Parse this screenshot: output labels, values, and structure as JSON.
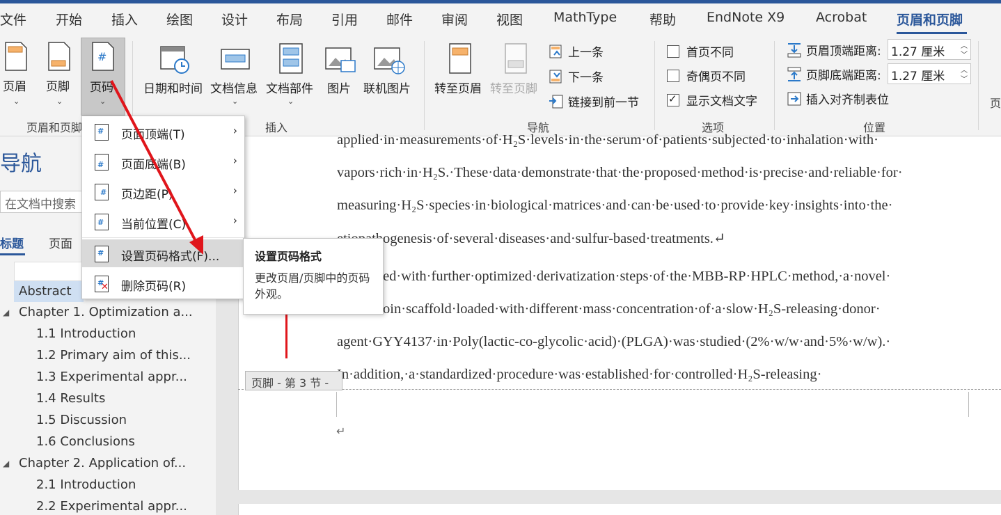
{
  "tabs": [
    "文件",
    "开始",
    "插入",
    "绘图",
    "设计",
    "布局",
    "引用",
    "邮件",
    "审阅",
    "视图",
    "MathType",
    "帮助",
    "EndNote X9",
    "Acrobat",
    "页眉和页脚"
  ],
  "ribbon": {
    "header_label": "页眉",
    "footer_label": "页脚",
    "page_number_label": "页码",
    "group_header_footer": "页眉和页脚",
    "datetime_label": "日期和时间",
    "docinfo_label": "文档信息",
    "docparts_label": "文档部件",
    "picture_label": "图片",
    "online_picture_label": "联机图片",
    "group_insert": "插入",
    "goto_header_label": "转至页眉",
    "goto_footer_label": "转至页脚",
    "prev_label": "上一条",
    "next_label": "下一条",
    "link_prev_label": "链接到前一节",
    "group_nav": "导航",
    "diff_first_label": "首页不同",
    "diff_oddeven_label": "奇偶页不同",
    "show_doc_text_label": "显示文档文字",
    "show_doc_text_checked": true,
    "group_options": "选项",
    "header_top_label": "页眉顶端距离:",
    "header_top_value": "1.27 厘米",
    "footer_bottom_label": "页脚底端距离:",
    "footer_bottom_value": "1.27 厘米",
    "insert_align_tab_label": "插入对齐制表位",
    "group_position": "位置",
    "cut_right_label": "页"
  },
  "dropdown": {
    "items": [
      {
        "label": "页面顶端(T)",
        "submenu": true
      },
      {
        "label": "页面底端(B)",
        "submenu": true
      },
      {
        "label": "页边距(P)",
        "submenu": true
      },
      {
        "label": "当前位置(C)",
        "submenu": true
      },
      {
        "label": "设置页码格式(F)...",
        "submenu": false
      },
      {
        "label": "删除页码(R)",
        "submenu": false
      }
    ]
  },
  "tooltip": {
    "title": "设置页码格式",
    "body": "更改页眉/页脚中的页码外观。"
  },
  "nav": {
    "title": "导航",
    "search_placeholder": "在文档中搜索",
    "tab_headings": "标题",
    "tab_pages": "页面",
    "items": [
      {
        "label": "Abstract",
        "level": 1
      },
      {
        "label": "Chapter 1. Optimization a...",
        "level": 1
      },
      {
        "label": "1.1 Introduction",
        "level": 2
      },
      {
        "label": "1.2 Primary aim of this...",
        "level": 2
      },
      {
        "label": "1.3 Experimental appr...",
        "level": 2
      },
      {
        "label": "1.4 Results",
        "level": 2
      },
      {
        "label": "1.5 Discussion",
        "level": 2
      },
      {
        "label": "1.6 Conclusions",
        "level": 2
      },
      {
        "label": "Chapter 2. Application of...",
        "level": 1
      },
      {
        "label": "2.1 Introduction",
        "level": 2
      },
      {
        "label": "2.2 Experimental appr...",
        "level": 2
      }
    ]
  },
  "doc": {
    "lines": [
      "applied·in·measurements·of·H₂S·levels·in·the·serum·of·patients·subjected·to·inhalation·with·",
      "vapors·rich·in·H₂S.·These·data·demonstrate·that·the·proposed·method·is·precise·and·reliable·for·",
      "measuring·H₂S·species·in·biological·matrices·and·can·be·used·to·provide·key·insights·into·the·",
      "etiopathogenesis·of·several·diseases·and·sulfur-based·treatments.↵",
      "Combined·with·further·optimized·derivatization·steps·of·the·MBB-RP·HPLC·method,·a·novel·",
      "silk-fibroin·scaffold·loaded·with·different·mass·concentration·of·a·slow·H₂S-releasing·donor·",
      "agent·GYY4137·in·Poly(lactic-co-glycolic·acid)·(PLGA)·was·studied·(2%·w/w·and·5%·w/w).·",
      "In·addition,·a·standardized·procedure·was·established·for·controlled·H₂S-releasing·"
    ],
    "footer_tag": "页脚 - 第 3 节 -",
    "footer_return": "↵"
  }
}
